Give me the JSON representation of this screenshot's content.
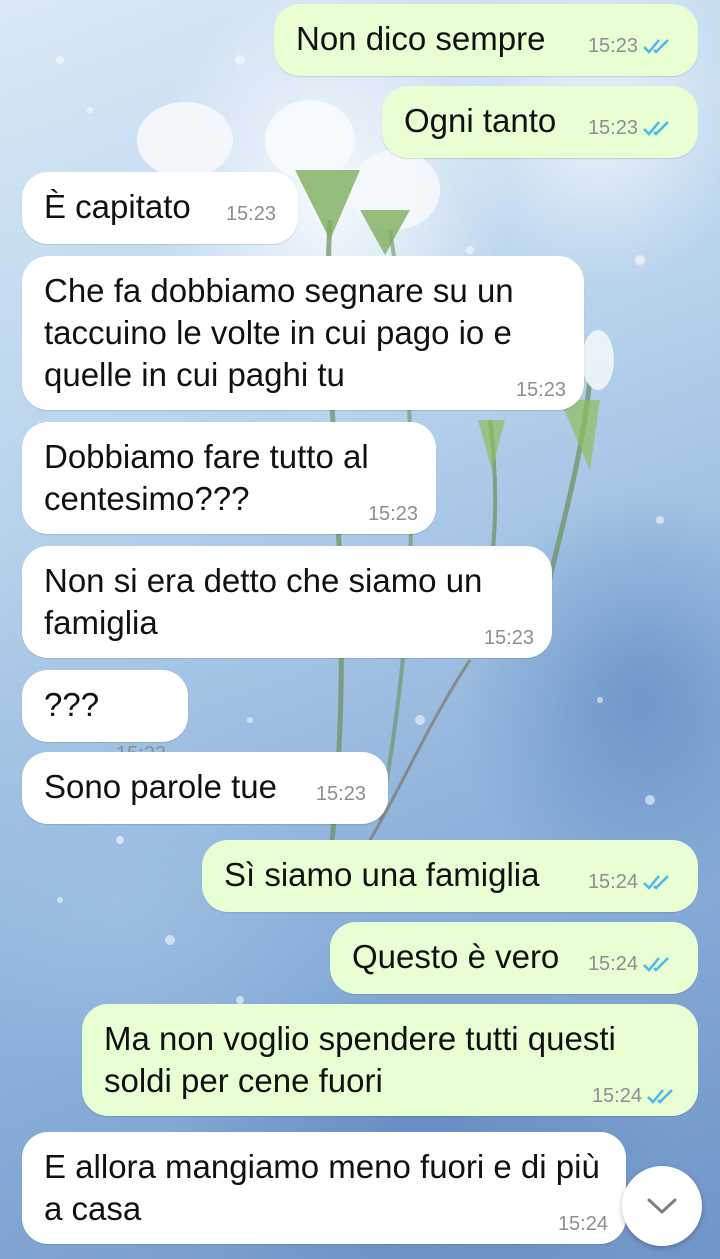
{
  "chat": {
    "messages": [
      {
        "dir": "out",
        "text": "Non dico sempre",
        "time": "15:23",
        "read": true
      },
      {
        "dir": "out",
        "text": "Ogni tanto",
        "time": "15:23",
        "read": true
      },
      {
        "dir": "in",
        "text": "È capitato",
        "time": "15:23"
      },
      {
        "dir": "in",
        "text": "Che fa dobbiamo segnare su un taccuino le volte in cui pago io e quelle in cui paghi tu",
        "time": "15:23"
      },
      {
        "dir": "in",
        "text": "Dobbiamo fare tutto al centesimo???",
        "time": "15:23"
      },
      {
        "dir": "in",
        "text": "Non si era detto che siamo un famiglia",
        "time": "15:23"
      },
      {
        "dir": "in",
        "text": "???",
        "time": "15:23"
      },
      {
        "dir": "in",
        "text": "Sono parole tue",
        "time": "15:23"
      },
      {
        "dir": "out",
        "text": "Sì siamo una famiglia",
        "time": "15:24",
        "read": true
      },
      {
        "dir": "out",
        "text": "Questo è vero",
        "time": "15:24",
        "read": true
      },
      {
        "dir": "out",
        "text": "Ma non voglio spendere tutti questi soldi per cene fuori",
        "time": "15:24",
        "read": true
      },
      {
        "dir": "in",
        "text": "E allora mangiamo meno fuori e di più a casa",
        "time": "15:24"
      }
    ],
    "scroll_button_icon": "chevron-down-icon",
    "colors": {
      "outgoing_bubble": "#e7ffd3",
      "incoming_bubble": "#ffffff",
      "read_ticks": "#4fb6ec",
      "timestamp": "#8a8f93"
    }
  }
}
